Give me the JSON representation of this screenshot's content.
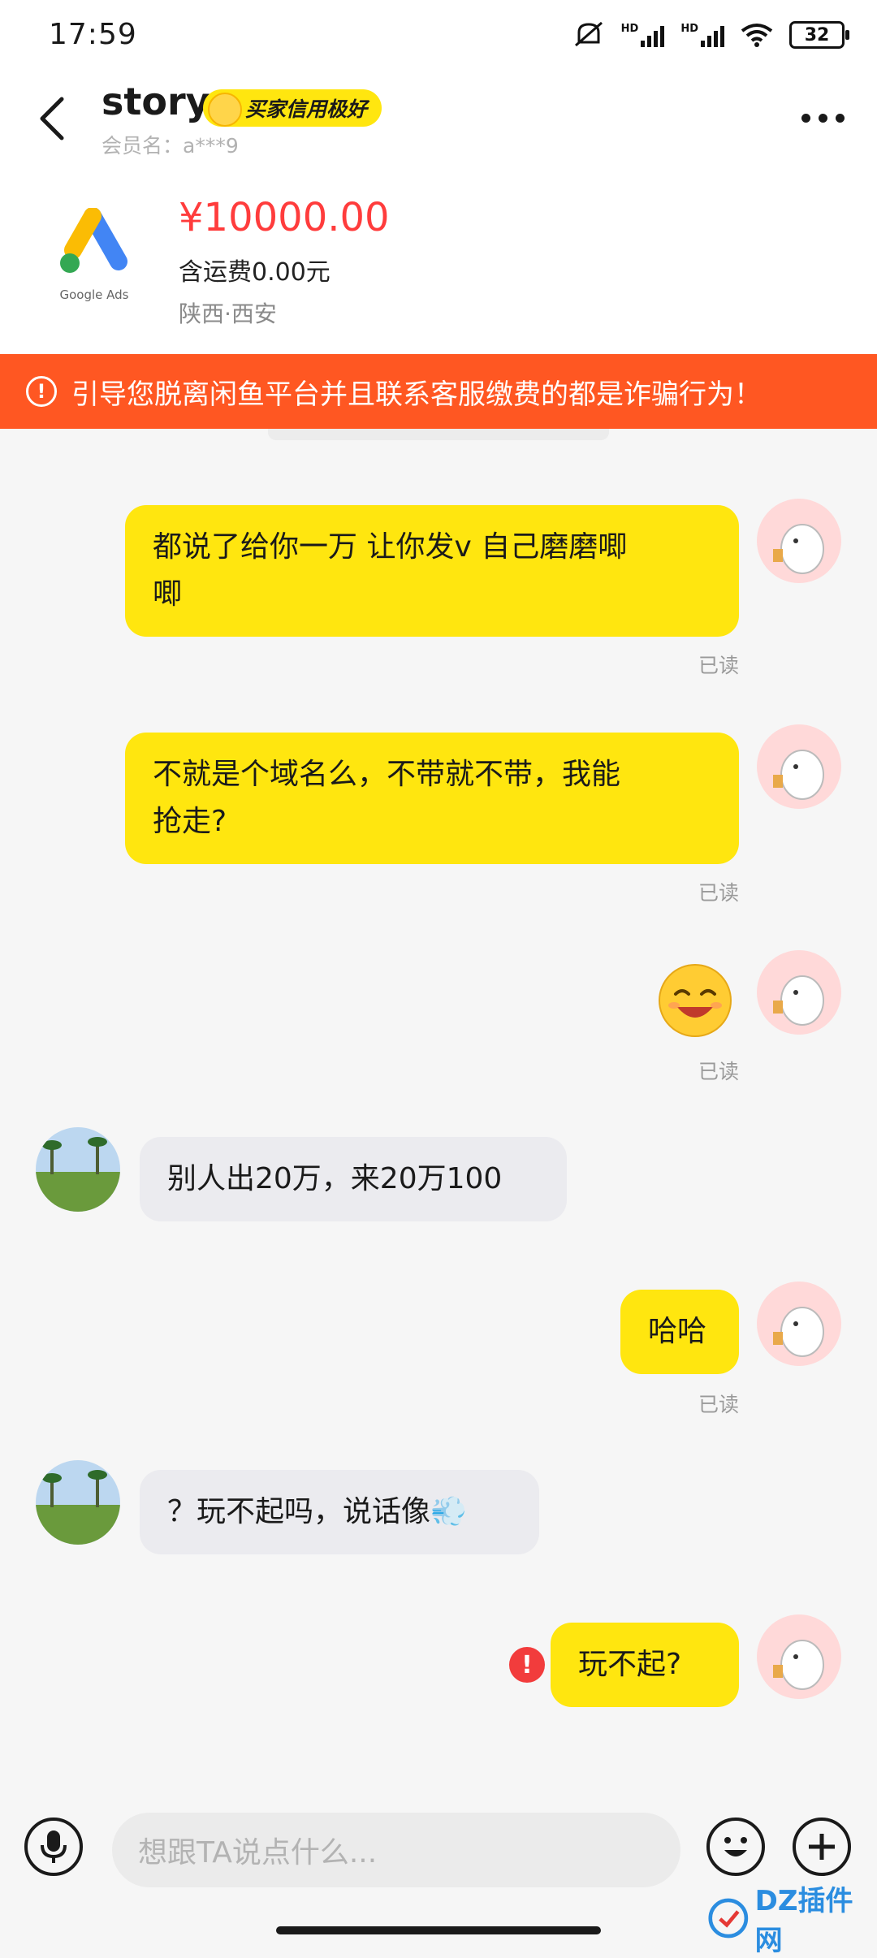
{
  "status_bar": {
    "time": "17:59",
    "network": "HD",
    "battery": "32"
  },
  "header": {
    "title": "story",
    "credit_badge": "买家信用极好",
    "member_label": "会员名：a***9"
  },
  "product": {
    "logo_text": "Google Ads",
    "price": "¥10000.00",
    "shipping": "含运费0.00元",
    "location": "陕西·西安"
  },
  "warning": {
    "text": "引导您脱离闲鱼平台并且联系客服缴费的都是诈骗行为！"
  },
  "messages": [
    {
      "text_line1": "都说了给你一万 让你发v  自己磨磨唧",
      "text_line2": "唧",
      "status": "已读"
    },
    {
      "text_line1": "不就是个域名么，不带就不带，我能",
      "text_line2": "抢走?",
      "status": "已读"
    },
    {
      "emoji": "grinning-face",
      "status": "已读"
    },
    {
      "text": "别人出20万，来20万100"
    },
    {
      "text": "哈哈",
      "status": "已读"
    },
    {
      "text": "？玩不起吗，说话像💨"
    },
    {
      "text": "玩不起?",
      "error": "!"
    }
  ],
  "input": {
    "placeholder": "想跟TA说点什么..."
  },
  "watermark": {
    "text": "DZ插件网"
  },
  "colors": {
    "accent": "#ffe60f",
    "warning": "#ff5722",
    "price": "#ff3c3c",
    "other_bubble": "#ebebef"
  }
}
